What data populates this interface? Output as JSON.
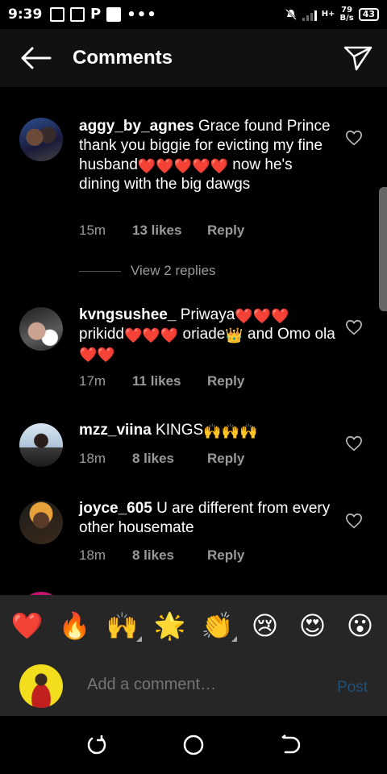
{
  "status_bar": {
    "time": "9:39",
    "network_speed_value": "79",
    "network_speed_unit": "B/s",
    "network_type": "H+",
    "battery": "43",
    "icons": [
      "gallery-icon",
      "shopping-bag-icon",
      "p-app-icon",
      "square-app-icon",
      "more-dots-icon",
      "mute-icon",
      "signal-icon",
      "battery-icon"
    ]
  },
  "header": {
    "title": "Comments",
    "back_icon": "arrow-left-icon",
    "send_icon": "paper-plane-icon"
  },
  "comments": [
    {
      "username": "aggy_by_agnes",
      "text_parts": [
        "Grace found Prince thank you biggie for evicting my fine husband",
        "❤️❤️❤️❤️❤️",
        " now he's dining with the big dawgs"
      ],
      "time": "15m",
      "likes": "13 likes",
      "reply": "Reply",
      "view_replies": "View 2 replies"
    },
    {
      "username": "kvngsushee_",
      "text_parts": [
        "Priwaya",
        "❤️❤️❤️",
        " prikidd",
        "❤️❤️❤️",
        " oriade",
        "👑",
        " and Omo ola",
        "❤️❤️"
      ],
      "time": "17m",
      "likes": "11 likes",
      "reply": "Reply"
    },
    {
      "username": "mzz_viina",
      "text_parts": [
        "KINGS",
        "🙌🙌🙌"
      ],
      "time": "18m",
      "likes": "8 likes",
      "reply": "Reply"
    },
    {
      "username": "joyce_605",
      "text_parts": [
        "U are different from every other housemate"
      ],
      "time": "18m",
      "likes": "8 likes",
      "reply": "Reply"
    }
  ],
  "emoji_bar": [
    "❤️",
    "🔥",
    "🙌",
    "🌟",
    "👏",
    "😢",
    "😍",
    "😮"
  ],
  "composer": {
    "placeholder": "Add a comment…",
    "post_label": "Post"
  },
  "colors": {
    "background": "#000000",
    "header_bg": "#111111",
    "panel_bg": "#262626",
    "meta_text": "#9a9a9a",
    "post_disabled": "#1e4f7a"
  }
}
